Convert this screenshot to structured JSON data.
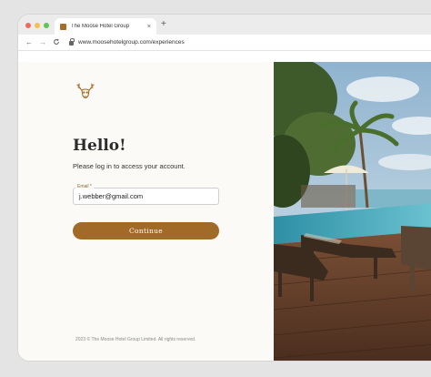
{
  "browser": {
    "tab_title": "The Moose Hotel Group",
    "tab_close": "×",
    "new_tab": "+",
    "back": "←",
    "forward": "→",
    "reload": "C",
    "url": "www.moosehotelgroup.com/experiences"
  },
  "login": {
    "logo_icon": "moose-head-icon",
    "heading": "Hello!",
    "subtitle": "Please log in to access your account.",
    "email_label": "Email *",
    "email_value": "j.webber@gmail.com",
    "continue_label": "Continue",
    "footer": "2023 © The Moose Hotel Group Limited. All rights reserved."
  },
  "colors": {
    "accent": "#a26a27",
    "left_background": "#fbfaf6"
  },
  "hero_image": {
    "icon": "resort-pool-photo"
  }
}
